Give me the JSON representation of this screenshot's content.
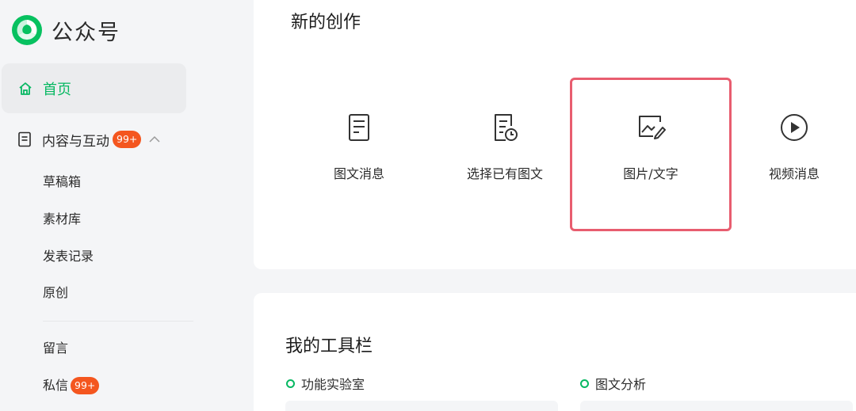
{
  "app": {
    "title": "公众号",
    "accent": "#07b862"
  },
  "sidebar": {
    "home": {
      "label": "首页",
      "icon": "home-icon"
    },
    "content": {
      "label": "内容与互动",
      "badge": "99+",
      "icon": "document-icon"
    },
    "content_items": [
      "草稿箱",
      "素材库",
      "发表记录",
      "原创"
    ],
    "message_items": [
      {
        "label": "留言"
      },
      {
        "label": "私信",
        "badge": "99+"
      }
    ]
  },
  "create": {
    "title": "新的创作",
    "items": [
      {
        "label": "图文消息",
        "icon": "article-icon"
      },
      {
        "label": "选择已有图文",
        "icon": "existing-article-icon"
      },
      {
        "label": "图片/文字",
        "icon": "image-edit-icon",
        "selected": true
      },
      {
        "label": "视频消息",
        "icon": "play-circle-icon"
      }
    ]
  },
  "tools": {
    "title": "我的工具栏",
    "sections": [
      {
        "label": "功能实验室"
      },
      {
        "label": "图文分析"
      }
    ]
  }
}
